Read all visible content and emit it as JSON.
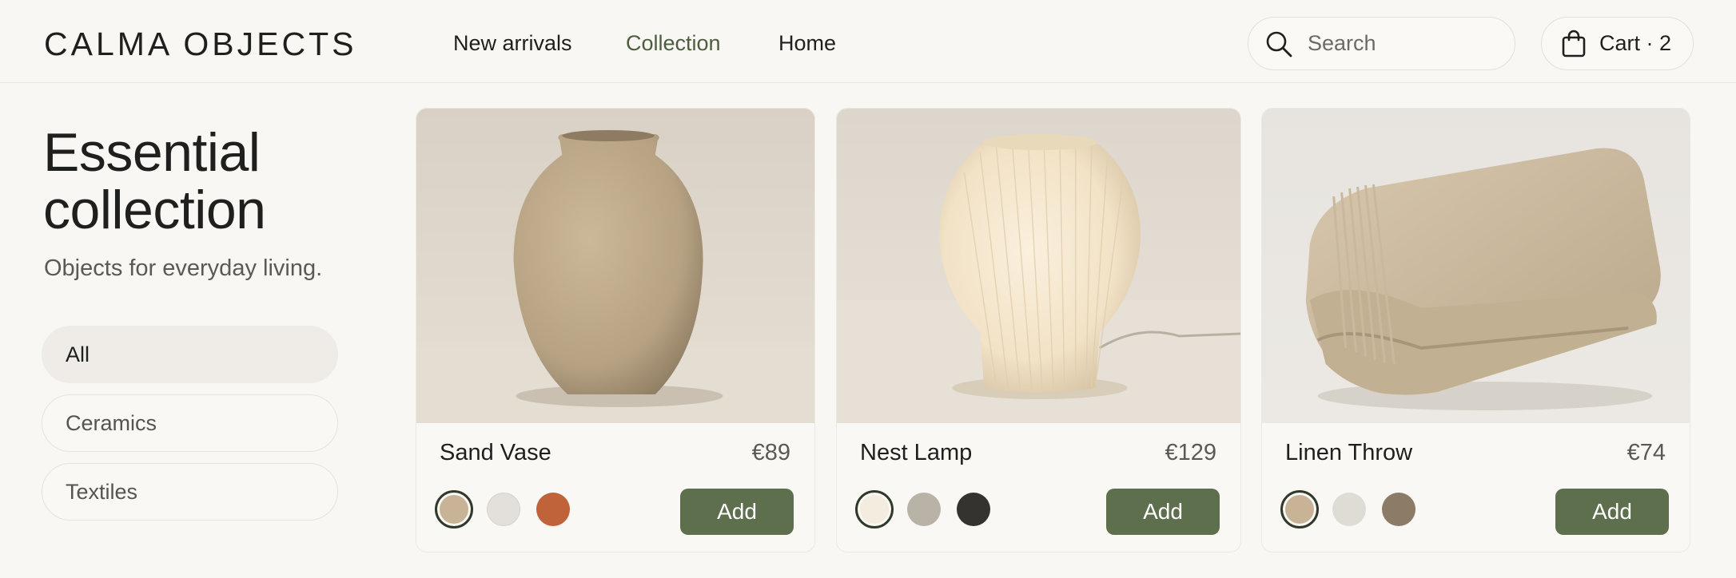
{
  "brand": "CALMA OBJECTS",
  "nav": [
    {
      "label": "New arrivals"
    },
    {
      "label": "Collection"
    },
    {
      "label": "Home"
    }
  ],
  "search": {
    "placeholder": "Search",
    "icon": "search-icon"
  },
  "cart": {
    "label": "Cart · 2",
    "icon": "shopping-bag-icon"
  },
  "page": {
    "title": "Essential collection",
    "title_line1": "Essential",
    "title_line2": "collection",
    "subtitle": "Objects for everyday living."
  },
  "filters": [
    {
      "label": "All",
      "active": true
    },
    {
      "label": "Ceramics",
      "active": false
    },
    {
      "label": "Textiles",
      "active": false
    }
  ],
  "products": [
    {
      "name": "Sand Vase",
      "price": "€89",
      "add_label": "Add",
      "swatches": [
        "#c8b396",
        "#e3e0db",
        "#c0623a"
      ],
      "selected_swatch": 0
    },
    {
      "name": "Nest Lamp",
      "price": "€129",
      "add_label": "Add",
      "swatches": [
        "#f5ece0",
        "#b9b2a6",
        "#34332f"
      ],
      "selected_swatch": 0
    },
    {
      "name": "Linen Throw",
      "price": "€74",
      "add_label": "Add",
      "swatches": [
        "#c9b396",
        "#dfdcd6",
        "#8c7b66"
      ],
      "selected_swatch": 0
    }
  ],
  "colors": {
    "accent": "#5d6f4c",
    "nav_active": "#4d5e3e",
    "background": "#f8f7f4"
  }
}
